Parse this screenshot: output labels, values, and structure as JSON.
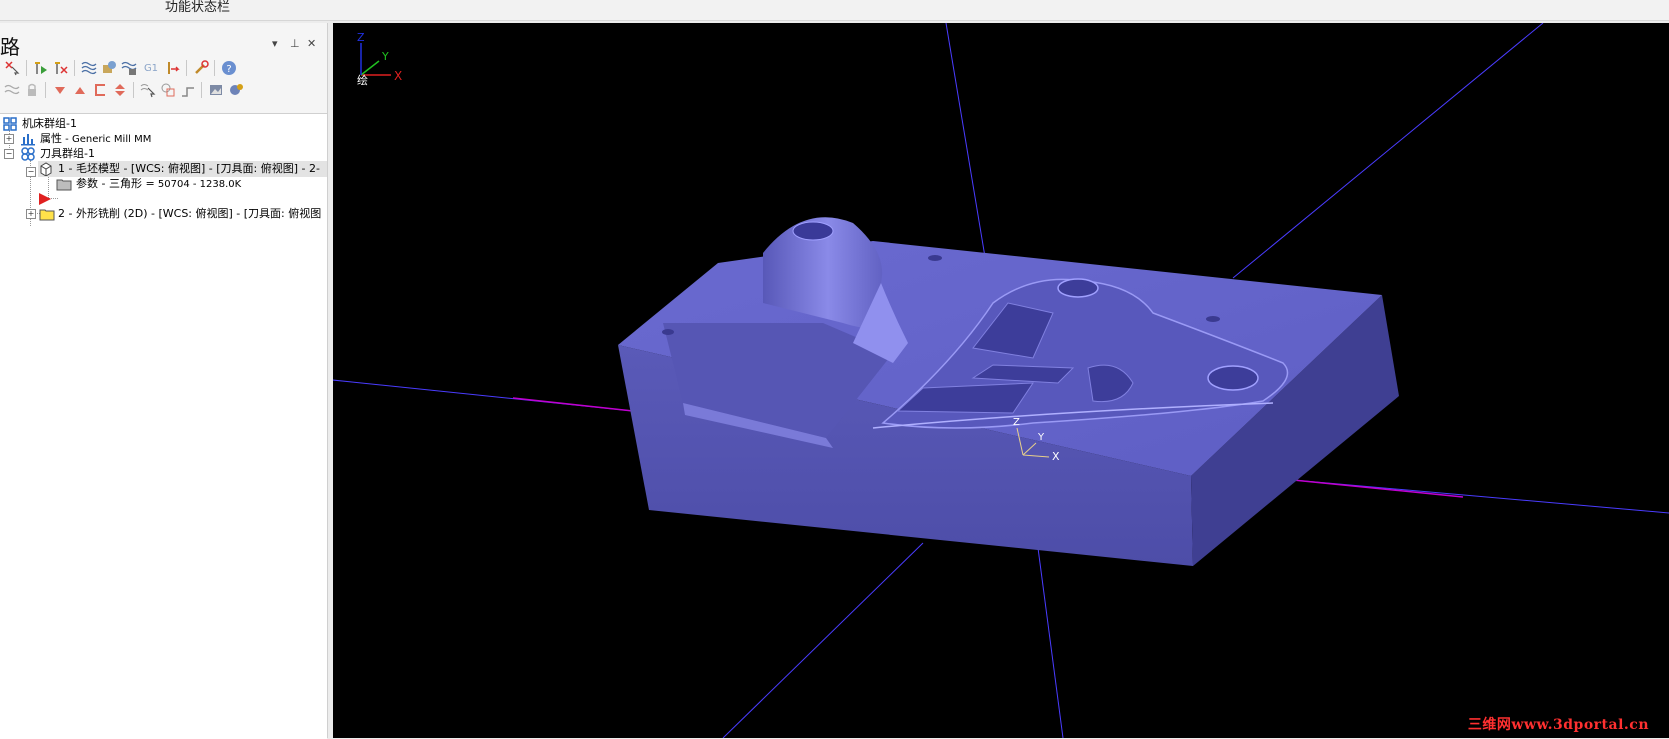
{
  "status_bar": {
    "title": "功能状态栏"
  },
  "panel": {
    "title": "路",
    "controls": {
      "dropdown": "▾",
      "pin": "⊥",
      "close": "✕"
    },
    "toolbar1": [
      {
        "icon": "select-x-icon"
      },
      {
        "icon": "add-op-icon"
      },
      {
        "icon": "delete-op-icon"
      },
      {
        "icon": "waves-icon"
      },
      {
        "icon": "stock-icon"
      },
      {
        "icon": "verify-icon"
      },
      {
        "icon": "g1-icon",
        "label": "G1"
      },
      {
        "icon": "post-icon"
      },
      {
        "icon": "wrench-icon"
      },
      {
        "icon": "help-icon"
      }
    ],
    "toolbar2": [
      {
        "icon": "waves-disabled-icon"
      },
      {
        "icon": "lock-icon"
      },
      {
        "icon": "arrow-down-icon"
      },
      {
        "icon": "arrow-up-icon"
      },
      {
        "icon": "insert-icon"
      },
      {
        "icon": "move-updown-icon"
      },
      {
        "icon": "select-cursor-icon"
      },
      {
        "icon": "copy-icon"
      },
      {
        "icon": "path-icon"
      },
      {
        "icon": "image-icon"
      },
      {
        "icon": "settings-gear-icon"
      }
    ]
  },
  "tree": {
    "machine_group": "机床群组-1",
    "properties_label": "属性",
    "properties_value": " - Generic Mill MM",
    "toolpath_group": "刀具群组-1",
    "op1": "1 - 毛坯模型 - [WCS: 俯视图] - [刀具面: 俯视图] - 2-",
    "param_label": "参数 - 三角形 =",
    "param_value": "  50704 - 1238.0K",
    "op2": "2 - 外形铣削 (2D) - [WCS: 俯视图] - [刀具面: 俯视图"
  },
  "viewport": {
    "background": "#000000",
    "part_color": "#6b6bd4",
    "axes": {
      "x": "X",
      "y": "Y",
      "z": "Z",
      "view_label": "绘"
    },
    "wcs": {
      "x": "X",
      "y": "Y",
      "z": "Z"
    },
    "watermark": "三维网www.3dportal.cn"
  },
  "colors": {
    "accent_red": "#e02020",
    "line_blue": "#4a3cff",
    "line_magenta": "#d000d0"
  }
}
